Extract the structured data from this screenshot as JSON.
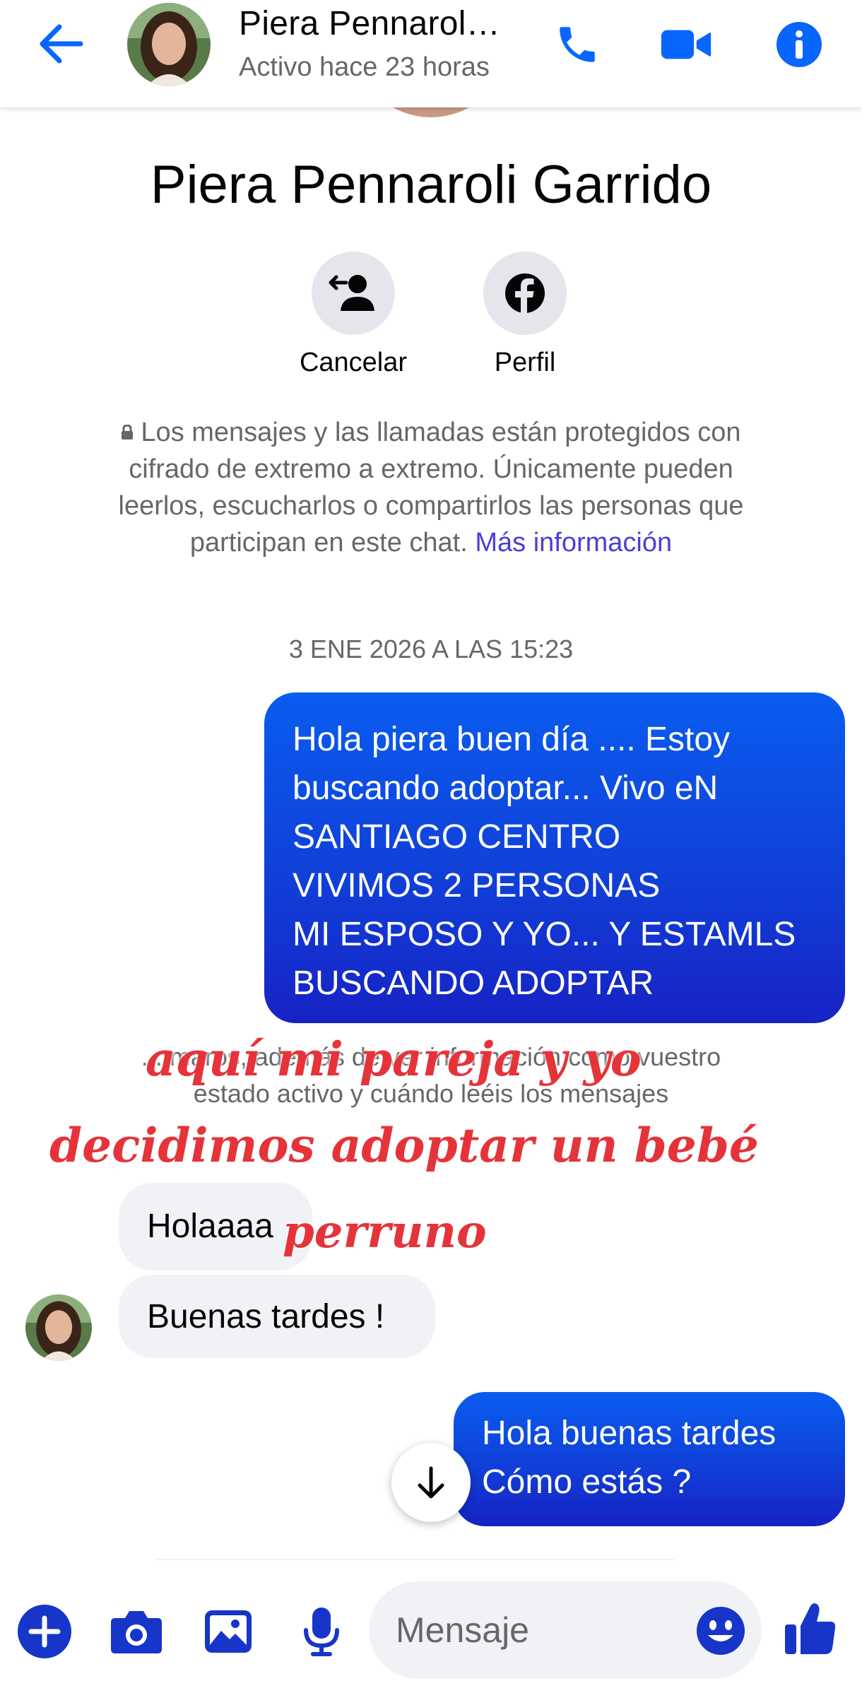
{
  "header": {
    "contact_name": "Piera Pennarol…",
    "status": "Activo hace 23 horas"
  },
  "profile": {
    "name": "Piera Pennaroli Garrido",
    "actions": {
      "cancel_label": "Cancelar",
      "profile_label": "Perfil"
    }
  },
  "encryption_notice": {
    "text": "Los mensajes y las llamadas están protegidos con cifrado de extremo a extremo. Únicamente pueden leerlos, escucharlos o compartirlos las personas que participan en este chat. ",
    "link": "Más información"
  },
  "conversation": {
    "timestamp": "3 ENE 2026 A LAS 15:23",
    "outgoing_1": "Hola piera buen día .... Estoy buscando adoptar... Vivo eN SANTIAGO CENTRO\nVIVIMOS 2 PERSONAS\nMI ESPOSO Y YO... Y ESTAMLS BUSCANDO ADOPTAR",
    "hidden_notice": "... maros, además de ver información como vuestro estado activo y cuándo leéis los mensajes",
    "incoming_1": "Holaaaa",
    "incoming_2": "Buenas tardes !",
    "outgoing_2": "Hola buenas tardes\nCómo estás ?"
  },
  "overlay_text": {
    "line1": "aquí mi pareja y yo",
    "line2": "decidimos adoptar un bebé",
    "line3": "perruno"
  },
  "composer": {
    "placeholder": "Mensaje"
  },
  "colors": {
    "messenger_blue": "#0866ff",
    "outgoing_bubble_top": "#0a5cf0",
    "outgoing_bubble_bottom": "#1722c4",
    "composer_icon": "#1735c8",
    "incoming_bubble": "#f0f2f5",
    "overlay_text": "#e5333a"
  }
}
